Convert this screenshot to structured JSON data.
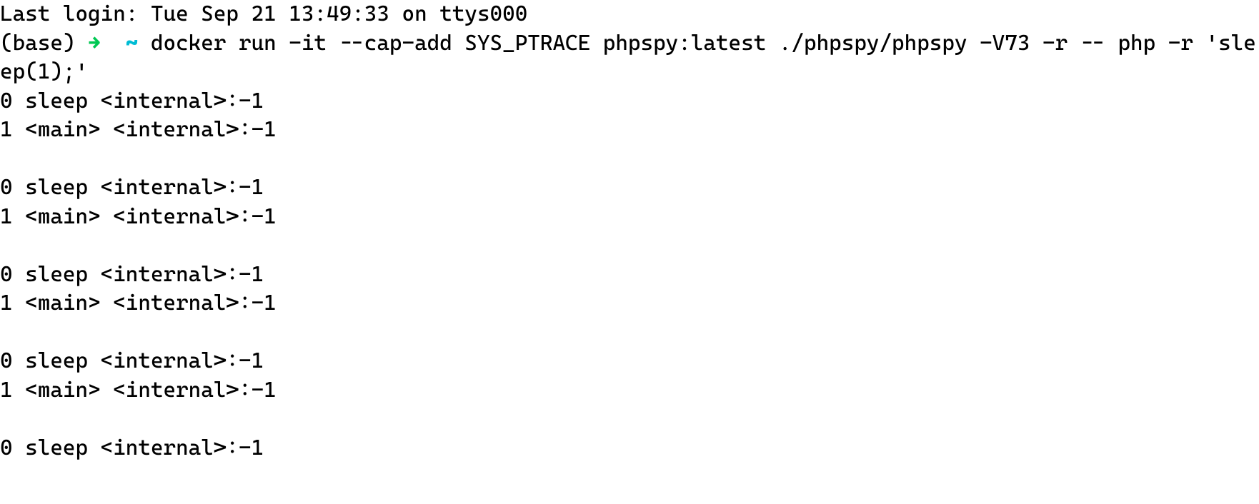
{
  "login_line": "Last login: Tue Sep 21 13:49:33 on ttys000",
  "prompt": {
    "env": "(base)",
    "arrow": "→",
    "tilde": "~"
  },
  "command": "docker run -it --cap-add SYS_PTRACE phpspy:latest ./phpspy/phpspy -V73 -r -- php -r 'sleep(1);'",
  "output_lines": [
    "0 sleep <internal>:-1",
    "1 <main> <internal>:-1",
    "",
    "0 sleep <internal>:-1",
    "1 <main> <internal>:-1",
    "",
    "0 sleep <internal>:-1",
    "1 <main> <internal>:-1",
    "",
    "0 sleep <internal>:-1",
    "1 <main> <internal>:-1",
    "",
    "0 sleep <internal>:-1"
  ]
}
